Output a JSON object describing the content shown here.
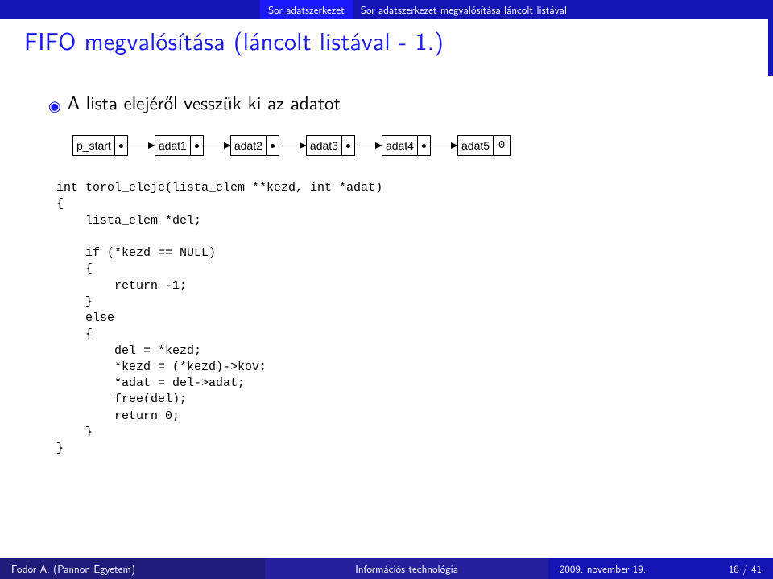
{
  "tabs": {
    "tab1": "Sor adatszerkezet",
    "tab2": "Sor adatszerkezet megvalósítása láncolt listával"
  },
  "title": "FIFO megvalósítása (láncolt listával - 1.)",
  "bullet_text": "A lista elejéről vesszük ki az adatot",
  "diagram": {
    "start": "p_start",
    "nodes": [
      "adat1",
      "adat2",
      "adat3",
      "adat4",
      "adat5"
    ],
    "tail": "0"
  },
  "code": "int torol_eleje(lista_elem **kezd, int *adat)\n{\n    lista_elem *del;\n\n    if (*kezd == NULL)\n    {\n        return -1;\n    }\n    else\n    {\n        del = *kezd;\n        *kezd = (*kezd)->kov;\n        *adat = del->adat;\n        free(del);\n        return 0;\n    }\n}",
  "footer": {
    "author": "Fodor A. (Pannon Egyetem)",
    "course": "Információs technológia",
    "date": "2009. november 19.",
    "page": "18 / 41"
  }
}
